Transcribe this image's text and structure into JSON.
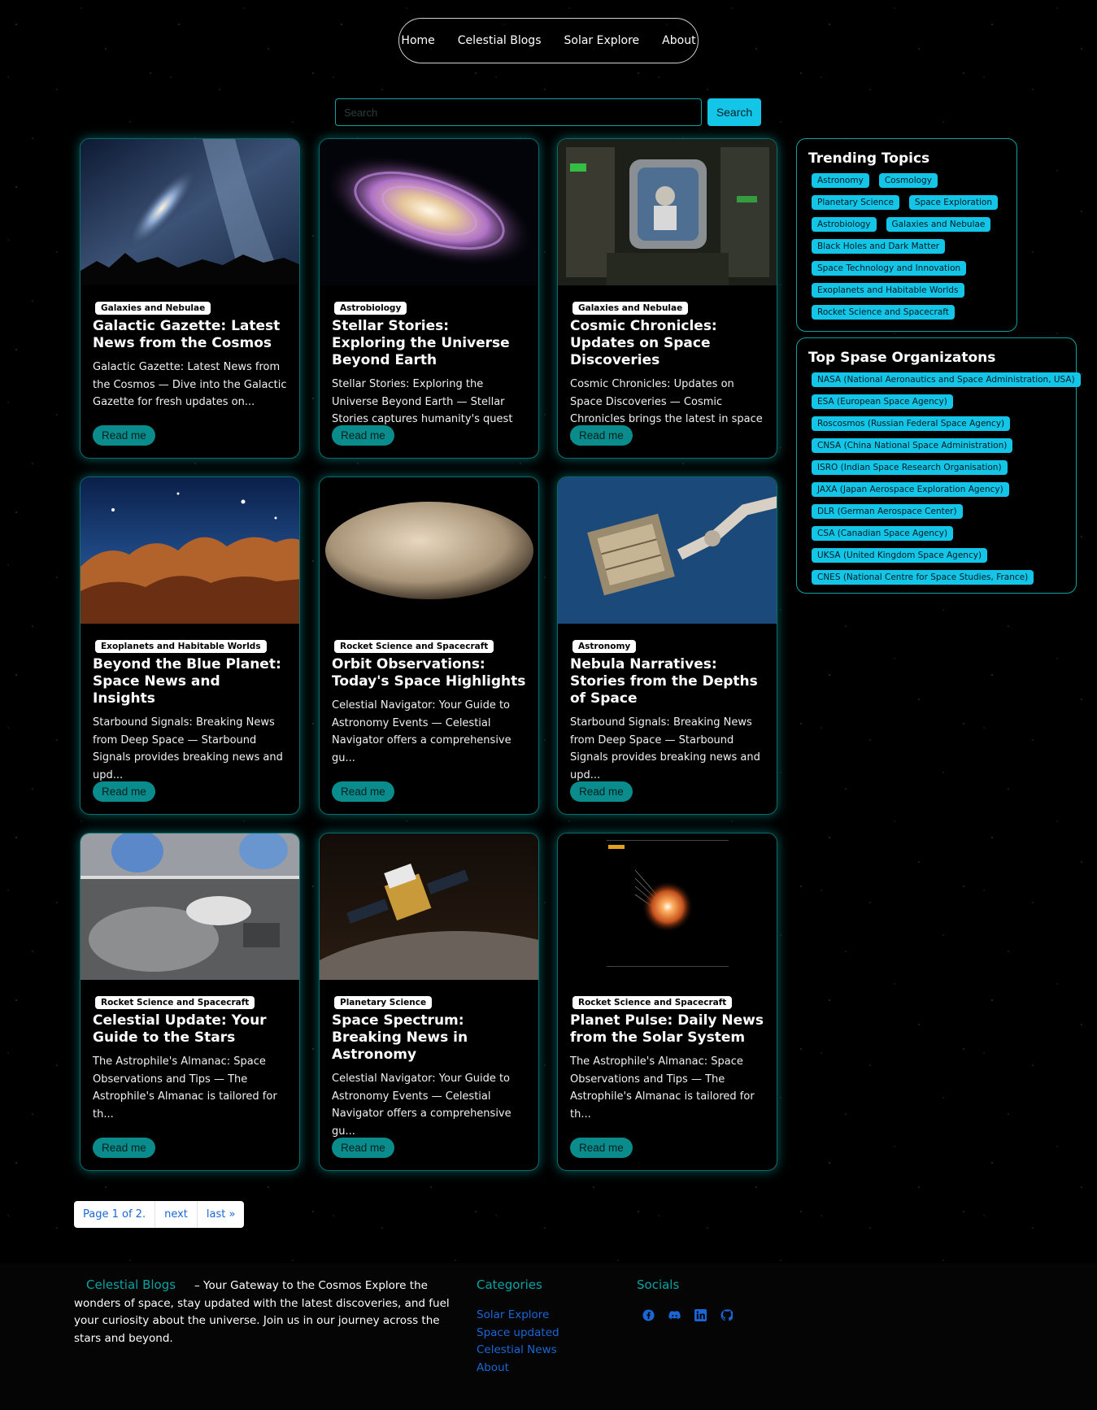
{
  "nav": {
    "items": [
      "Home",
      "Celestial Blogs",
      "Solar Explore",
      "About"
    ]
  },
  "search": {
    "placeholder": "Search",
    "button_label": "Search"
  },
  "posts": [
    {
      "category": "Galaxies and Nebulae",
      "title": "Galactic Gazette: Latest News from the Cosmos",
      "excerpt": "Galactic Gazette: Latest News from the Cosmos — Dive into the Galactic Gazette for fresh updates on...",
      "read_label": "Read me"
    },
    {
      "category": "Astrobiology",
      "title": "Stellar Stories: Exploring the Universe Beyond Earth",
      "excerpt": "Stellar Stories: Exploring the Universe Beyond Earth — Stellar Stories captures humanity's quest to...",
      "read_label": "Read me"
    },
    {
      "category": "Galaxies and Nebulae",
      "title": "Cosmic Chronicles: Updates on Space Discoveries",
      "excerpt": "Cosmic Chronicles: Updates on Space Discoveries — Cosmic Chronicles brings the latest in space scie...",
      "read_label": "Read me"
    },
    {
      "category": "Exoplanets and Habitable Worlds",
      "title": "Beyond the Blue Planet: Space News and Insights",
      "excerpt": "Starbound Signals: Breaking News from Deep Space — Starbound Signals provides breaking news and upd...",
      "read_label": "Read me"
    },
    {
      "category": "Rocket Science and Spacecraft",
      "title": "Orbit Observations: Today's Space Highlights",
      "excerpt": "Celestial Navigator: Your Guide to Astronomy Events — Celestial Navigator offers a comprehensive gu...",
      "read_label": "Read me"
    },
    {
      "category": "Astronomy",
      "title": "Nebula Narratives: Stories from the Depths of Space",
      "excerpt": "Starbound Signals: Breaking News from Deep Space — Starbound Signals provides breaking news and upd...",
      "read_label": "Read me"
    },
    {
      "category": "Rocket Science and Spacecraft",
      "title": "Celestial Update: Your Guide to the Stars",
      "excerpt": "The Astrophile's Almanac: Space Observations and Tips — The Astrophile's Almanac is tailored for th...",
      "read_label": "Read me"
    },
    {
      "category": "Planetary Science",
      "title": "Space Spectrum: Breaking News in Astronomy",
      "excerpt": "Celestial Navigator: Your Guide to Astronomy Events — Celestial Navigator offers a comprehensive gu...",
      "read_label": "Read me"
    },
    {
      "category": "Rocket Science and Spacecraft",
      "title": "Planet Pulse: Daily News from the Solar System",
      "excerpt": "The Astrophile's Almanac: Space Observations and Tips — The Astrophile's Almanac is tailored for th...",
      "read_label": "Read me"
    }
  ],
  "trending": {
    "title": "Trending Topics",
    "tags": [
      "Astronomy",
      "Cosmology",
      "Planetary Science",
      "Space Exploration",
      "Astrobiology",
      "Galaxies and Nebulae",
      "Black Holes and Dark Matter",
      "Space Technology and Innovation",
      "Exoplanets and Habitable Worlds",
      "Rocket Science and Spacecraft"
    ]
  },
  "organizations": {
    "title": "Top Spase Organizatons",
    "tags": [
      "NASA (National Aeronautics and Space Administration, USA)",
      "ESA (European Space Agency)",
      "Roscosmos (Russian Federal Space Agency)",
      "CNSA (China National Space Administration)",
      "ISRO (Indian Space Research Organisation)",
      "JAXA (Japan Aerospace Exploration Agency)",
      "DLR (German Aerospace Center)",
      "CSA (Canadian Space Agency)",
      "UKSA (United Kingdom Space Agency)",
      "CNES (National Centre for Space Studies, France)"
    ]
  },
  "pagination": {
    "current": "Page 1 of 2.",
    "next": "next",
    "last": "last »"
  },
  "footer": {
    "brand": "Celestial Blogs",
    "description": "– Your Gateway to the Cosmos Explore the wonders of space, stay updated with the latest discoveries, and fuel your curiosity about the universe. Join us in our journey across the stars and beyond.",
    "categories_title": "Categories",
    "category_links": [
      "Solar Explore",
      "Space updated",
      "Celestial News",
      "About"
    ],
    "socials_title": "Socials",
    "social_icons": [
      "facebook-icon",
      "discord-icon",
      "linkedin-icon",
      "github-icon"
    ]
  },
  "colors": {
    "accent": "#0aa3a3",
    "tag_bg": "#13c6e8",
    "link": "#1a66d6"
  }
}
